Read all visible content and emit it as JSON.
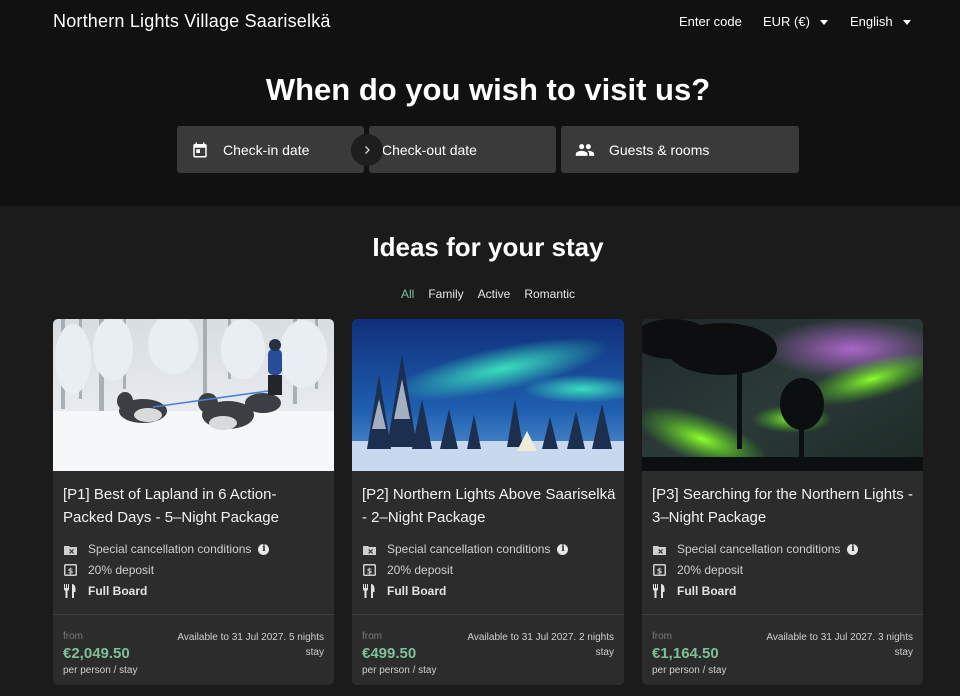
{
  "header": {
    "brand": "Northern Lights Village Saariselkä",
    "enter_code": "Enter code",
    "currency": "EUR (€)",
    "language": "English"
  },
  "hero": {
    "title": "When do you wish to visit us?",
    "checkin": "Check-in date",
    "checkout": "Check-out date",
    "guests": "Guests & rooms"
  },
  "ideas": {
    "title": "Ideas for your stay",
    "filters": [
      "All",
      "Family",
      "Active",
      "Romantic"
    ],
    "active_filter": "All"
  },
  "cards": [
    {
      "title": "[P1] Best of Lapland in 6 Action-Packed Days - 5–Night Package",
      "cancellation": "Special cancellation conditions",
      "deposit": "20% deposit",
      "board": "Full Board",
      "from": "from",
      "price": "€2,049.50",
      "per": "per person / stay",
      "availability": "Available to 31 Jul 2027. 5 nights stay"
    },
    {
      "title": "[P2] Northern Lights Above Saariselkä - 2–Night Package",
      "cancellation": "Special cancellation conditions",
      "deposit": "20% deposit",
      "board": "Full Board",
      "from": "from",
      "price": "€499.50",
      "per": "per person / stay",
      "availability": "Available to 31 Jul 2027. 2 nights stay"
    },
    {
      "title": "[P3] Searching for the Northern Lights - 3–Night Package",
      "cancellation": "Special cancellation conditions",
      "deposit": "20% deposit",
      "board": "Full Board",
      "from": "from",
      "price": "€1,164.50",
      "per": "per person / stay",
      "availability": "Available to 31 Jul 2027. 3 nights stay"
    }
  ],
  "colors": {
    "accent": "#7fbf9a",
    "header_bg": "#111111",
    "page_bg": "#1b1b1b",
    "card_bg": "#2c2c2c"
  },
  "icons": [
    "calendar-icon",
    "chevron-right-icon",
    "people-icon",
    "info-icon",
    "cancellation-icon",
    "deposit-icon",
    "cutlery-icon"
  ]
}
